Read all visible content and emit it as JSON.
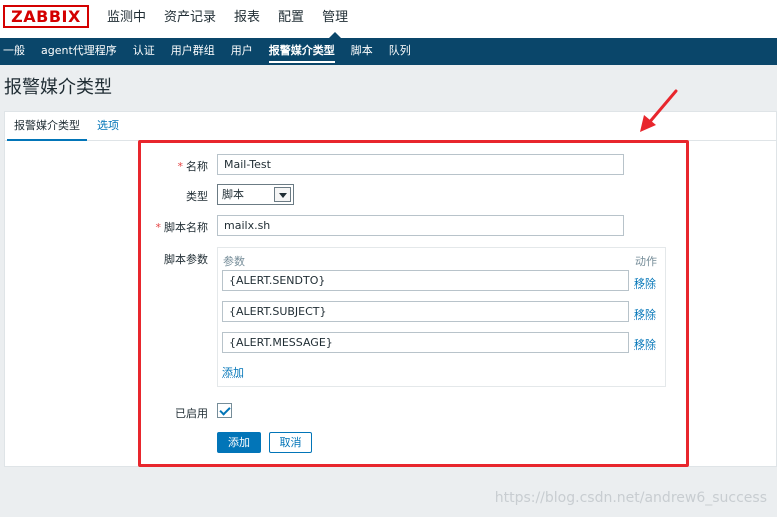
{
  "logo": "ZABBIX",
  "main_menu": [
    "监测中",
    "资产记录",
    "报表",
    "配置",
    "管理"
  ],
  "sub_menu": [
    "一般",
    "agent代理程序",
    "认证",
    "用户群组",
    "用户",
    "报警媒介类型",
    "脚本",
    "队列"
  ],
  "page_title": "报警媒介类型",
  "tabs": [
    "报警媒介类型",
    "选项"
  ],
  "form": {
    "name_label": "名称",
    "name_value": "Mail-Test",
    "type_label": "类型",
    "type_value": "脚本",
    "script_name_label": "脚本名称",
    "script_name_value": "mailx.sh",
    "script_params_label": "脚本参数",
    "params_header": "参数",
    "action_header": "动作",
    "params": [
      "{ALERT.SENDTO}",
      "{ALERT.SUBJECT}",
      "{ALERT.MESSAGE}"
    ],
    "remove_label": "移除",
    "add_param_label": "添加",
    "enabled_label": "已启用",
    "enabled": true,
    "add_button": "添加",
    "cancel_button": "取消"
  },
  "watermark": "https://blog.csdn.net/andrew6_success",
  "colors": {
    "brand_red": "#d40000",
    "nav_blue": "#0a466a",
    "link_blue": "#0275b8",
    "annotation_red": "#e8262d"
  }
}
